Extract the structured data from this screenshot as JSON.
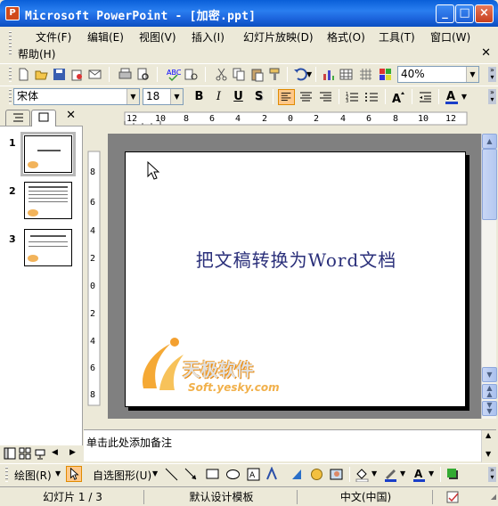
{
  "window": {
    "title": "Microsoft PowerPoint - [加密.ppt]",
    "icon": "powerpoint-icon"
  },
  "menu": {
    "items": [
      "文件(F)",
      "编辑(E)",
      "视图(V)",
      "插入(I)",
      "幻灯片放映(D)",
      "格式(O)",
      "工具(T)",
      "窗口(W)",
      "帮助(H)"
    ]
  },
  "standard_toolbar": {
    "zoom": "40%"
  },
  "format_toolbar": {
    "font": "宋体",
    "size": "18",
    "bold": "B",
    "italic": "I",
    "underline": "U",
    "shadow": "S"
  },
  "slides_pane": {
    "slides": [
      {
        "number": "1"
      },
      {
        "number": "2"
      },
      {
        "number": "3"
      }
    ]
  },
  "ruler": {
    "h_labels": [
      "12",
      "10",
      "8",
      "6",
      "4",
      "2",
      "0",
      "2",
      "4",
      "6",
      "8",
      "10",
      "12"
    ],
    "v_labels": [
      "8",
      "6",
      "4",
      "2",
      "0",
      "2",
      "4",
      "6",
      "8"
    ]
  },
  "slide": {
    "title": "把文稿转换为Word文档",
    "logo_text": "天极软件",
    "logo_sub": "Soft.yesky.com"
  },
  "notes": {
    "placeholder": "单击此处添加备注"
  },
  "draw_toolbar": {
    "draw_label": "绘图(R)",
    "autoshapes_label": "自选图形(U)"
  },
  "status": {
    "slide": "幻灯片 1 / 3",
    "design": "默认设计模板",
    "language": "中文(中国)"
  },
  "colors": {
    "title_bar": "#0a5fd8",
    "slide_title": "#2a2f7a",
    "logo_orange": "#e88a10"
  }
}
